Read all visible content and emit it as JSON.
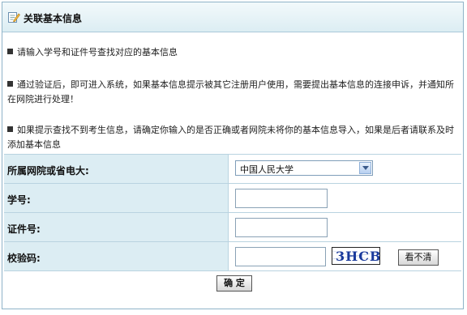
{
  "header": {
    "title": "关联基本信息",
    "icon": "edit-note-icon"
  },
  "notes": [
    "请输入学号和证件号查找对应的基本信息",
    "通过验证后，即可进入系统，如果基本信息提示被其它注册用户使用，需要提出基本信息的连接申诉，并通知所在网院进行处理！",
    "如果提示查找不到考生信息，请确定你输入的是否正确或者网院未将你的基本信息导入，如果是后者请联系及时添加基本信息"
  ],
  "form": {
    "school_label": "所属网院或省电大:",
    "school_selected": "中国人民大学",
    "student_id_label": "学号:",
    "student_id_value": "",
    "cert_label": "证件号:",
    "cert_value": "",
    "captcha_label": "校验码:",
    "captcha_value": "",
    "captcha_text": "3HCB",
    "refresh_label": "看不清",
    "submit_label": "确 定"
  },
  "colors": {
    "label_bg": "#dcedf3",
    "border": "#b9d3e0",
    "captcha_ink": "#1a3a9c"
  }
}
